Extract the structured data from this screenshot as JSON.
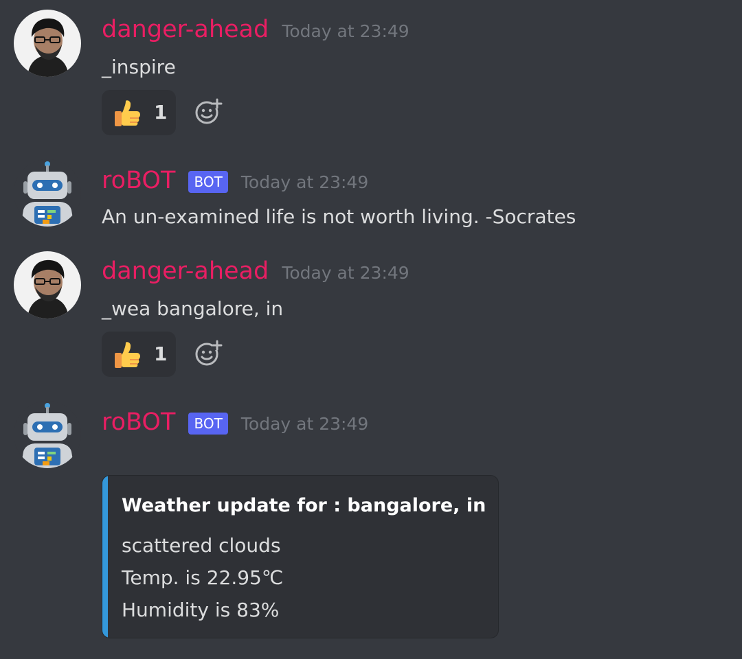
{
  "messages": [
    {
      "username": "danger-ahead",
      "timestamp": "Today at 23:49",
      "content": "_inspire",
      "reaction": {
        "emoji": "thumbs-up",
        "count": "1"
      }
    },
    {
      "username": "roBOT",
      "bot_tag": "BOT",
      "timestamp": "Today at 23:49",
      "content": "An un-examined life is not worth living. -Socrates"
    },
    {
      "username": "danger-ahead",
      "timestamp": "Today at 23:49",
      "content": "_wea bangalore, in",
      "reaction": {
        "emoji": "thumbs-up",
        "count": "1"
      }
    },
    {
      "username": "roBOT",
      "bot_tag": "BOT",
      "timestamp": "Today at 23:49",
      "embed": {
        "title": "Weather update for :  bangalore, in",
        "lines": [
          "scattered clouds",
          "Temp. is 22.95℃",
          "Humidity is 83%"
        ],
        "accent_color": "#3498db"
      }
    }
  ],
  "colors": {
    "background": "#36393f",
    "username": "#e91e63",
    "bot_tag": "#5865f2",
    "timestamp": "#72767d",
    "text": "#dcddde"
  },
  "icons": {
    "reaction": "thumbs-up-icon",
    "add_reaction": "add-reaction-icon"
  }
}
